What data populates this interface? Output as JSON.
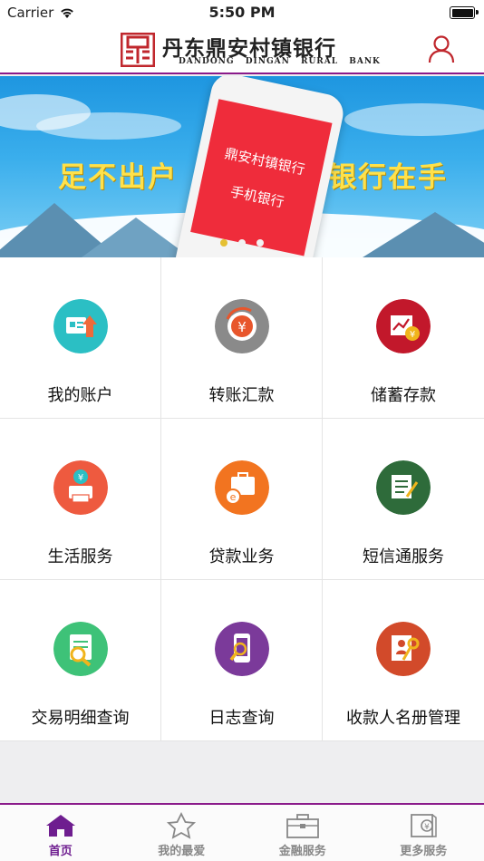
{
  "status": {
    "carrier": "Carrier",
    "time": "5:50 PM"
  },
  "header": {
    "bank_name_cn": "丹东鼎安村镇银行",
    "bank_name_en": "DANDONG DINGAN RURAL BANK",
    "logo_icon": "ding-logo",
    "user_icon": "user-icon"
  },
  "banner": {
    "slogan_left": "足不出户",
    "slogan_right": "银行在手",
    "phone_line1": "鼎安村镇银行",
    "phone_line2": "手机银行",
    "page_count": 3,
    "active_page": 1
  },
  "services": [
    {
      "label": "我的账户",
      "icon": "account-icon",
      "color": "#2bbfc4"
    },
    {
      "label": "转账汇款",
      "icon": "transfer-icon",
      "color": "#8a8a8a"
    },
    {
      "label": "储蓄存款",
      "icon": "savings-icon",
      "color": "#c2182b"
    },
    {
      "label": "生活服务",
      "icon": "life-service-icon",
      "color": "#ee5a3f"
    },
    {
      "label": "贷款业务",
      "icon": "loan-icon",
      "color": "#f27420"
    },
    {
      "label": "短信通服务",
      "icon": "sms-icon",
      "color": "#2e6b3a"
    },
    {
      "label": "交易明细查询",
      "icon": "transaction-query-icon",
      "color": "#3ec278"
    },
    {
      "label": "日志查询",
      "icon": "log-query-icon",
      "color": "#7b3a9a"
    },
    {
      "label": "收款人名册管理",
      "icon": "payee-management-icon",
      "color": "#d24a2a"
    }
  ],
  "tabs": [
    {
      "label": "首页",
      "icon": "home-icon",
      "active": true
    },
    {
      "label": "我的最爱",
      "icon": "star-icon",
      "active": false
    },
    {
      "label": "金融服务",
      "icon": "briefcase-icon",
      "active": false
    },
    {
      "label": "更多服务",
      "icon": "more-services-icon",
      "active": false
    }
  ],
  "colors": {
    "accent": "#8a1a8a",
    "tab_active": "#6e1d8f",
    "tab_inactive": "#888888"
  }
}
